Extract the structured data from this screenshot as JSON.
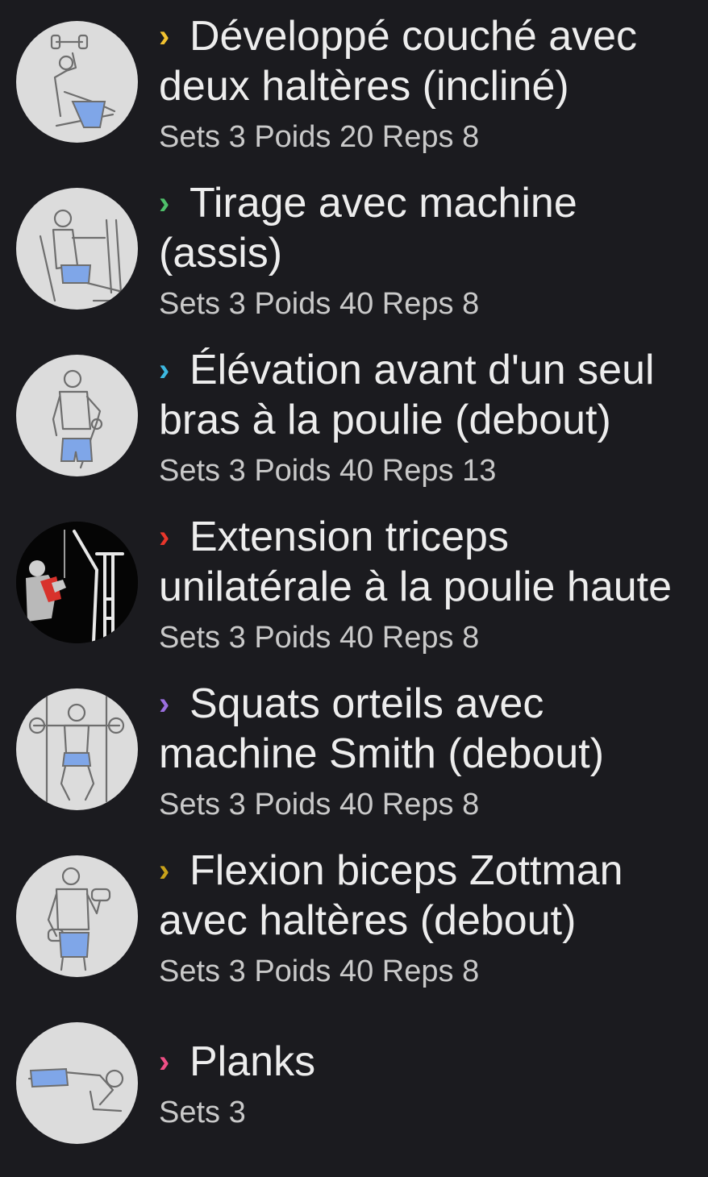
{
  "exercises": [
    {
      "title": "Développé couché avec deux haltères (incliné)",
      "chevron_color": "#f2c230",
      "icon": "incline-dumbbell-press-icon",
      "sets_label": "Sets",
      "sets": "3",
      "weight_label": "Poids",
      "weight": "20",
      "reps_label": "Reps",
      "reps": "8"
    },
    {
      "title": "Tirage avec machine (assis)",
      "chevron_color": "#4fbf6a",
      "icon": "seated-machine-row-icon",
      "sets_label": "Sets",
      "sets": "3",
      "weight_label": "Poids",
      "weight": "40",
      "reps_label": "Reps",
      "reps": "8"
    },
    {
      "title": "Élévation avant d'un seul bras à la poulie (debout)",
      "chevron_color": "#3cb8e0",
      "icon": "cable-front-raise-icon",
      "sets_label": "Sets",
      "sets": "3",
      "weight_label": "Poids",
      "weight": "40",
      "reps_label": "Reps",
      "reps": "13"
    },
    {
      "title": "Extension triceps unilatérale à la poulie haute",
      "chevron_color": "#e8362b",
      "icon": "cable-triceps-extension-icon",
      "sets_label": "Sets",
      "sets": "3",
      "weight_label": "Poids",
      "weight": "40",
      "reps_label": "Reps",
      "reps": "8"
    },
    {
      "title": "Squats orteils avec machine Smith (debout)",
      "chevron_color": "#9b6fe0",
      "icon": "smith-machine-squat-icon",
      "sets_label": "Sets",
      "sets": "3",
      "weight_label": "Poids",
      "weight": "40",
      "reps_label": "Reps",
      "reps": "8"
    },
    {
      "title": "Flexion biceps Zottman avec haltères (debout)",
      "chevron_color": "#c9a21a",
      "icon": "zottman-curl-icon",
      "sets_label": "Sets",
      "sets": "3",
      "weight_label": "Poids",
      "weight": "40",
      "reps_label": "Reps",
      "reps": "8"
    },
    {
      "title": "Planks",
      "chevron_color": "#ef4f86",
      "icon": "plank-icon",
      "sets_label": "Sets",
      "sets": "3"
    }
  ]
}
